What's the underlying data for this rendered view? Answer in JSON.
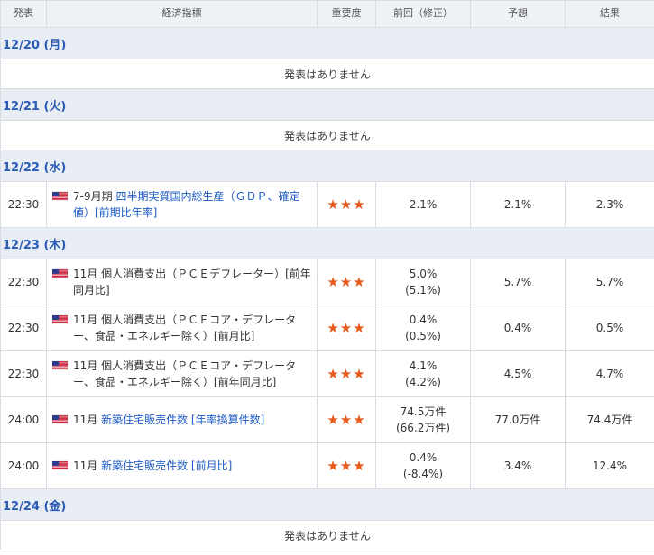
{
  "headers": {
    "time": "発表",
    "indicator": "経済指標",
    "importance": "重要度",
    "previous": "前回（修正）",
    "forecast": "予想",
    "result": "結果"
  },
  "days": [
    {
      "date": "12/20 (月)",
      "no_events_text": "発表はありません",
      "events": []
    },
    {
      "date": "12/21 (火)",
      "no_events_text": "発表はありません",
      "events": []
    },
    {
      "date": "12/22 (水)",
      "events": [
        {
          "time": "22:30",
          "flag": "us-flag-icon",
          "prefix": "7-9月期",
          "link_text": "四半期実質国内総生産（ＧＤＰ、確定値）[前期比年率]",
          "linked": true,
          "stars": "★★★",
          "previous": "2.1%",
          "revised": "",
          "forecast": "2.1%",
          "result": "2.3%"
        }
      ]
    },
    {
      "date": "12/23 (木)",
      "events": [
        {
          "time": "22:30",
          "flag": "us-flag-icon",
          "prefix": "11月",
          "link_text": "個人消費支出（ＰＣＥデフレーター）[前年同月比]",
          "linked": false,
          "stars": "★★★",
          "previous": "5.0%",
          "revised": "(5.1%)",
          "forecast": "5.7%",
          "result": "5.7%"
        },
        {
          "time": "22:30",
          "flag": "us-flag-icon",
          "prefix": "11月",
          "link_text": "個人消費支出（ＰＣＥコア・デフレーター、食品・エネルギー除く）[前月比]",
          "linked": false,
          "stars": "★★★",
          "previous": "0.4%",
          "revised": "(0.5%)",
          "forecast": "0.4%",
          "result": "0.5%"
        },
        {
          "time": "22:30",
          "flag": "us-flag-icon",
          "prefix": "11月",
          "link_text": "個人消費支出（ＰＣＥコア・デフレーター、食品・エネルギー除く）[前年同月比]",
          "linked": false,
          "stars": "★★★",
          "previous": "4.1%",
          "revised": "(4.2%)",
          "forecast": "4.5%",
          "result": "4.7%"
        },
        {
          "time": "24:00",
          "flag": "us-flag-icon",
          "prefix": "11月",
          "link_text": "新築住宅販売件数 [年率換算件数]",
          "linked": true,
          "stars": "★★★",
          "previous": "74.5万件",
          "revised": "(66.2万件)",
          "forecast": "77.0万件",
          "result": "74.4万件"
        },
        {
          "time": "24:00",
          "flag": "us-flag-icon",
          "prefix": "11月",
          "link_text": "新築住宅販売件数 [前月比]",
          "linked": true,
          "stars": "★★★",
          "previous": "0.4%",
          "revised": "(-8.4%)",
          "forecast": "3.4%",
          "result": "12.4%"
        }
      ]
    },
    {
      "date": "12/24 (金)",
      "no_events_text": "発表はありません",
      "events": []
    }
  ]
}
